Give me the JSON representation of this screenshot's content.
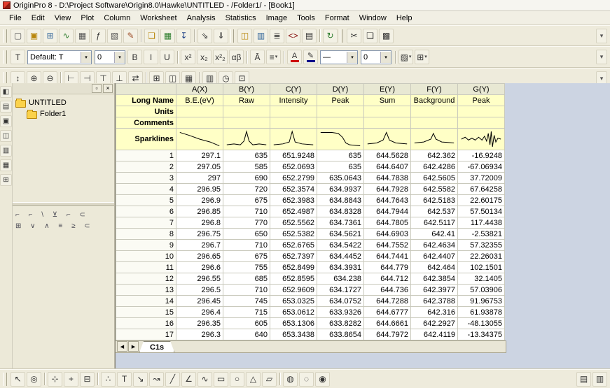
{
  "window": {
    "title": "OriginPro 8 - D:\\Project Software\\Origin8.0\\Hawke\\UNTITLED - /Folder1/ - [Book1]"
  },
  "menu": {
    "items": [
      "File",
      "Edit",
      "View",
      "Plot",
      "Column",
      "Worksheet",
      "Analysis",
      "Statistics",
      "Image",
      "Tools",
      "Format",
      "Window",
      "Help"
    ]
  },
  "toolbars": {
    "overflow_glyph": "▾",
    "standard": [
      "~",
      {
        "name": "new-project-icon",
        "glyph": "▢",
        "color": "#555"
      },
      {
        "name": "new-folder-icon",
        "glyph": "▣",
        "color": "#b8860b"
      },
      {
        "name": "new-workbook-icon",
        "glyph": "⊞",
        "color": "#336699"
      },
      {
        "name": "new-graph-icon",
        "glyph": "∿",
        "color": "#2d7d2d"
      },
      {
        "name": "new-matrix-icon",
        "glyph": "▦",
        "color": "#555"
      },
      {
        "name": "new-function-icon",
        "glyph": "ƒ",
        "color": "#333"
      },
      {
        "name": "new-layout-icon",
        "glyph": "▧",
        "color": "#555"
      },
      {
        "name": "new-notes-icon",
        "glyph": "✎",
        "color": "#a0522d"
      },
      "|",
      {
        "name": "open-icon",
        "glyph": "❏",
        "color": "#b8860b"
      },
      {
        "name": "open-excel-icon",
        "glyph": "▦",
        "color": "#2d7d2d"
      },
      {
        "name": "save-icon",
        "glyph": "↧",
        "color": "#224488"
      },
      "|",
      {
        "name": "import-wizard-icon",
        "glyph": "⇘",
        "color": "#333"
      },
      {
        "name": "import-ascii-icon",
        "glyph": "⇓",
        "color": "#333"
      },
      "~",
      {
        "name": "project-explorer-icon",
        "glyph": "◫",
        "color": "#b8860b"
      },
      {
        "name": "results-log-icon",
        "glyph": "▥",
        "color": "#336699"
      },
      {
        "name": "script-window-icon",
        "glyph": "≣",
        "color": "#333"
      },
      {
        "name": "code-builder-icon",
        "glyph": "<>",
        "color": "#800000"
      },
      {
        "name": "print-icon",
        "glyph": "▤",
        "color": "#333"
      },
      "|",
      {
        "name": "refresh-icon",
        "glyph": "↻",
        "color": "#2d7d2d"
      },
      "~",
      {
        "name": "cut-icon",
        "glyph": "✂",
        "color": "#333"
      },
      {
        "name": "copy-icon",
        "glyph": "❏",
        "color": "#333"
      },
      {
        "name": "paste-icon",
        "glyph": "▩",
        "color": "#333"
      }
    ],
    "format": {
      "pre_icon_glyph": "T",
      "style_value": "Default: T",
      "size_value": "0",
      "font_color_glyph": "A",
      "pen_color_glyph": "✎",
      "line_style_value": "—",
      "line_width_value": "0",
      "dropdown_glyph": "▾"
    },
    "format_left": [
      {
        "name": "bold-button",
        "glyph": "B"
      },
      {
        "name": "italic-button",
        "glyph": "I"
      },
      {
        "name": "underline-button",
        "glyph": "U"
      },
      "|",
      {
        "name": "superscript-button",
        "glyph": "x²"
      },
      {
        "name": "subscript-button",
        "glyph": "x₂"
      },
      {
        "name": "supsub-button",
        "glyph": "x²₂"
      },
      {
        "name": "greek-button",
        "glyph": "αβ"
      },
      "|",
      {
        "name": "annotation-button",
        "glyph": "Ā"
      },
      {
        "name": "align-button",
        "glyph": "≡",
        "drop": true
      },
      "|"
    ],
    "format_right": [
      "|",
      {
        "name": "fill-pattern-dropdown",
        "glyph": "▨",
        "drop": true
      },
      {
        "name": "border-grid-dropdown",
        "glyph": "⊞",
        "drop": true
      }
    ],
    "tools": [
      "~",
      {
        "name": "rescale-icon",
        "glyph": "↕"
      },
      {
        "name": "zoom-in-icon",
        "glyph": "⊕"
      },
      {
        "name": "zoom-out-icon",
        "glyph": "⊖"
      },
      "|",
      {
        "name": "new-left-axis-icon",
        "glyph": "⊢"
      },
      {
        "name": "new-right-axis-icon",
        "glyph": "⊣"
      },
      {
        "name": "new-top-axis-icon",
        "glyph": "⊤"
      },
      {
        "name": "new-bottom-axis-icon",
        "glyph": "⊥"
      },
      {
        "name": "exchange-axes-icon",
        "glyph": "⇄"
      },
      "|",
      {
        "name": "add-layer-icon",
        "glyph": "⊞"
      },
      {
        "name": "extract-layer-icon",
        "glyph": "◫"
      },
      {
        "name": "merge-layer-icon",
        "glyph": "▦"
      },
      "|",
      {
        "name": "layer-panel-icon",
        "glyph": "▥"
      },
      {
        "name": "date-time-icon",
        "glyph": "◷"
      },
      {
        "name": "object-grid-icon",
        "glyph": "⊡"
      }
    ],
    "bottom": [
      "~",
      {
        "name": "pointer-tool-icon",
        "glyph": "↖"
      },
      {
        "name": "zoom-tool-icon",
        "glyph": "◎"
      },
      "|",
      {
        "name": "data-reader-icon",
        "glyph": "⊹"
      },
      {
        "name": "screen-reader-icon",
        "glyph": "+"
      },
      {
        "name": "data-selector-icon",
        "glyph": "⊟"
      },
      "|",
      {
        "name": "draw-data-icon",
        "glyph": "∴"
      },
      {
        "name": "text-tool-icon",
        "glyph": "T"
      },
      {
        "name": "arrow-tool-icon",
        "glyph": "↘"
      },
      {
        "name": "curved-arrow-tool-icon",
        "glyph": "↝"
      },
      {
        "name": "line-tool-icon",
        "glyph": "╱"
      },
      {
        "name": "polyline-tool-icon",
        "glyph": "∠"
      },
      {
        "name": "freehand-tool-icon",
        "glyph": "∿"
      },
      {
        "name": "rectangle-tool-icon",
        "glyph": "▭"
      },
      {
        "name": "circle-tool-icon",
        "glyph": "○"
      },
      {
        "name": "polygon-tool-icon",
        "glyph": "△"
      },
      {
        "name": "region-tool-icon",
        "glyph": "▱"
      },
      "|",
      {
        "name": "mask-tool-icon",
        "glyph": "◍"
      },
      {
        "name": "unmask-tool-icon",
        "glyph": "◌"
      },
      {
        "name": "mask-toggle-icon",
        "glyph": "◉"
      }
    ],
    "bottom_right": [
      {
        "name": "new-graph-window-icon",
        "glyph": "▤"
      },
      {
        "name": "new-table-window-icon",
        "glyph": "▥"
      }
    ],
    "left": [
      {
        "name": "dock-graph-icon",
        "glyph": "◧"
      },
      {
        "name": "dock-2d-graph-icon",
        "glyph": "▤"
      },
      {
        "name": "dock-3d-graph-icon",
        "glyph": "▣"
      },
      {
        "name": "dock-column-icon",
        "glyph": "◫"
      },
      {
        "name": "dock-layout-icon",
        "glyph": "▥"
      },
      {
        "name": "dock-mask-icon",
        "glyph": "▦"
      },
      {
        "name": "dock-edit-icon",
        "glyph": "⊞"
      }
    ]
  },
  "project_explorer": {
    "root_label": "UNTITLED",
    "folder_label": "Folder1",
    "pin_glyph": "▫",
    "close_glyph": "×",
    "pane_row1": "⌐ ⌐ \\ ⊻ ⌐ ⊂",
    "pane_row2": "⊞ ∨ ∧ ≡ ≥ ⊂"
  },
  "worksheet": {
    "tab": "C1s",
    "tab_scroll_left": "◀",
    "tab_scroll_right": "▶",
    "columns": [
      "A(X)",
      "B(Y)",
      "C(Y)",
      "D(Y)",
      "E(Y)",
      "F(Y)",
      "G(Y)"
    ],
    "row_labels": [
      "Long Name",
      "Units",
      "Comments",
      "Sparklines"
    ],
    "long_names": [
      "B.E.(eV)",
      "Raw",
      "Intensity",
      "Peak",
      "Sum",
      "Background",
      "Peak"
    ],
    "sparklines": [
      [
        [
          3,
          4
        ],
        [
          25,
          7
        ],
        [
          50,
          11
        ],
        [
          75,
          14
        ],
        [
          97,
          18
        ]
      ],
      [
        [
          3,
          17
        ],
        [
          20,
          16
        ],
        [
          35,
          17
        ],
        [
          44,
          13
        ],
        [
          50,
          3
        ],
        [
          56,
          13
        ],
        [
          65,
          17
        ],
        [
          80,
          16
        ],
        [
          97,
          17
        ]
      ],
      [
        [
          3,
          17
        ],
        [
          25,
          16
        ],
        [
          40,
          14
        ],
        [
          47,
          3
        ],
        [
          54,
          14
        ],
        [
          70,
          16
        ],
        [
          97,
          17
        ]
      ],
      [
        [
          3,
          4
        ],
        [
          30,
          4
        ],
        [
          45,
          5
        ],
        [
          55,
          9
        ],
        [
          63,
          15
        ],
        [
          72,
          17
        ],
        [
          97,
          18
        ]
      ],
      [
        [
          3,
          16
        ],
        [
          25,
          15
        ],
        [
          40,
          12
        ],
        [
          48,
          4
        ],
        [
          55,
          12
        ],
        [
          70,
          15
        ],
        [
          97,
          16
        ]
      ],
      [
        [
          3,
          15
        ],
        [
          25,
          14
        ],
        [
          42,
          11
        ],
        [
          48,
          5
        ],
        [
          54,
          11
        ],
        [
          68,
          14
        ],
        [
          97,
          15
        ]
      ],
      [
        [
          3,
          11
        ],
        [
          12,
          9
        ],
        [
          20,
          12
        ],
        [
          28,
          10
        ],
        [
          36,
          12
        ],
        [
          44,
          9
        ],
        [
          52,
          12
        ],
        [
          58,
          8
        ],
        [
          63,
          13
        ],
        [
          67,
          5
        ],
        [
          71,
          17
        ],
        [
          74,
          3
        ],
        [
          77,
          19
        ],
        [
          81,
          7
        ],
        [
          85,
          14
        ],
        [
          90,
          10
        ],
        [
          97,
          11
        ]
      ]
    ],
    "rows": [
      [
        "297.1",
        "635",
        "651.9248",
        "635",
        "644.5628",
        "642.362",
        "-16.9248"
      ],
      [
        "297.05",
        "585",
        "652.0693",
        "635",
        "644.6407",
        "642.4286",
        "-67.06934"
      ],
      [
        "297",
        "690",
        "652.2799",
        "635.0643",
        "644.7838",
        "642.5605",
        "37.72009"
      ],
      [
        "296.95",
        "720",
        "652.3574",
        "634.9937",
        "644.7928",
        "642.5582",
        "67.64258"
      ],
      [
        "296.9",
        "675",
        "652.3983",
        "634.8843",
        "644.7643",
        "642.5183",
        "22.60175"
      ],
      [
        "296.85",
        "710",
        "652.4987",
        "634.8328",
        "644.7944",
        "642.537",
        "57.50134"
      ],
      [
        "296.8",
        "770",
        "652.5562",
        "634.7361",
        "644.7805",
        "642.5117",
        "117.4438"
      ],
      [
        "296.75",
        "650",
        "652.5382",
        "634.5621",
        "644.6903",
        "642.41",
        "-2.53821"
      ],
      [
        "296.7",
        "710",
        "652.6765",
        "634.5422",
        "644.7552",
        "642.4634",
        "57.32355"
      ],
      [
        "296.65",
        "675",
        "652.7397",
        "634.4452",
        "644.7441",
        "642.4407",
        "22.26031"
      ],
      [
        "296.6",
        "755",
        "652.8499",
        "634.3931",
        "644.779",
        "642.464",
        "102.1501"
      ],
      [
        "296.55",
        "685",
        "652.8595",
        "634.238",
        "644.712",
        "642.3854",
        "32.1405"
      ],
      [
        "296.5",
        "710",
        "652.9609",
        "634.1727",
        "644.736",
        "642.3977",
        "57.03906"
      ],
      [
        "296.45",
        "745",
        "653.0325",
        "634.0752",
        "644.7288",
        "642.3788",
        "91.96753"
      ],
      [
        "296.4",
        "715",
        "653.0612",
        "633.9326",
        "644.6777",
        "642.316",
        "61.93878"
      ],
      [
        "296.35",
        "605",
        "653.1306",
        "633.8282",
        "644.6661",
        "642.2927",
        "-48.13055"
      ],
      [
        "296.3",
        "640",
        "653.3438",
        "633.8654",
        "644.7972",
        "642.4119",
        "-13.34375"
      ]
    ]
  }
}
